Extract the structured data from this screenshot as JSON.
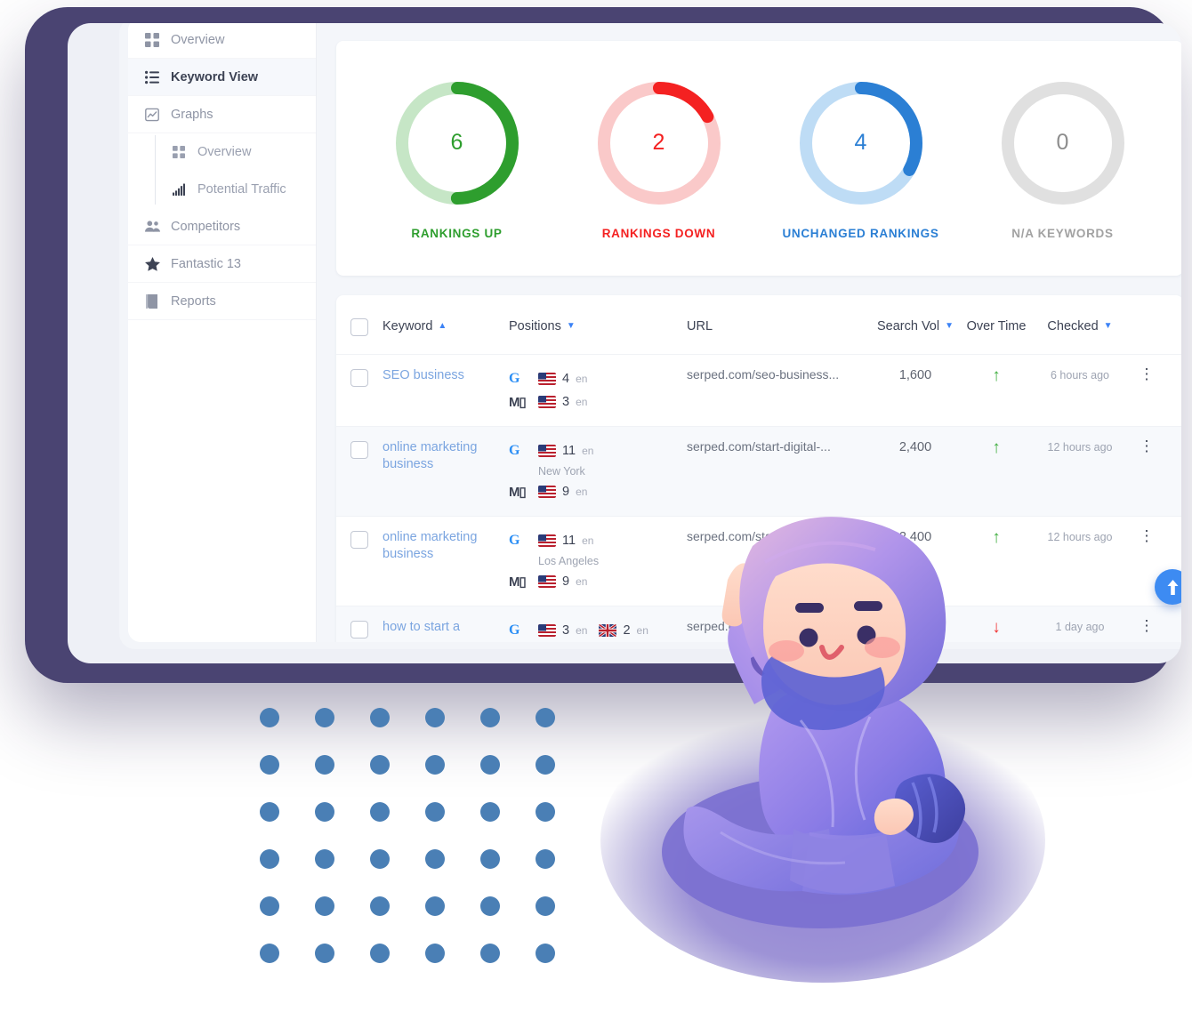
{
  "sidebar": {
    "items": [
      {
        "label": "Overview",
        "icon": "grid-icon",
        "active": false
      },
      {
        "label": "Keyword View",
        "icon": "list-icon",
        "active": true
      },
      {
        "label": "Graphs",
        "icon": "chart-area-icon",
        "active": false
      },
      {
        "label": "Competitors",
        "icon": "users-icon",
        "active": false
      },
      {
        "label": "Fantastic 13",
        "icon": "star-icon",
        "active": false
      },
      {
        "label": "Reports",
        "icon": "book-icon",
        "active": false
      }
    ],
    "sub_items": [
      {
        "label": "Overview",
        "icon": "grid-icon"
      },
      {
        "label": "Potential Traffic",
        "icon": "bar-chart-icon"
      }
    ]
  },
  "stats": [
    {
      "value": "6",
      "label": "RANKINGS UP",
      "color": "#2e9e2e",
      "track": "#c6e6c6",
      "percent": 50
    },
    {
      "value": "2",
      "label": "RANKINGS DOWN",
      "color": "#f42121",
      "track": "#fac9c9",
      "percent": 17
    },
    {
      "value": "4",
      "label": "UNCHANGED RANKINGS",
      "color": "#2b7fd4",
      "track": "#bedcf5",
      "percent": 33
    },
    {
      "value": "0",
      "label": "N/A KEYWORDS",
      "color": "#a0a0a0",
      "track": "#e0e0e0",
      "percent": 0
    }
  ],
  "table": {
    "columns": [
      {
        "label": "Keyword",
        "sort": "asc"
      },
      {
        "label": "Positions",
        "sort": "desc"
      },
      {
        "label": "URL",
        "sort": null
      },
      {
        "label": "Search Vol",
        "sort": "desc"
      },
      {
        "label": "Over Time",
        "sort": null
      },
      {
        "label": "Checked",
        "sort": "desc"
      }
    ],
    "rows": [
      {
        "keyword": "SEO business",
        "positions": [
          {
            "engine": "G",
            "flag": "us",
            "rank": "4",
            "lang": "en",
            "location": ""
          },
          {
            "engine": "M",
            "flag": "us",
            "rank": "3",
            "lang": "en",
            "location": ""
          }
        ],
        "url": "serped.com/seo-business...",
        "volume": "1,600",
        "trend": "up",
        "checked": "6 hours ago"
      },
      {
        "keyword": "online marketing business",
        "positions": [
          {
            "engine": "G",
            "flag": "us",
            "rank": "11",
            "lang": "en",
            "location": "New York"
          },
          {
            "engine": "M",
            "flag": "us",
            "rank": "9",
            "lang": "en",
            "location": ""
          }
        ],
        "url": "serped.com/start-digital-...",
        "volume": "2,400",
        "trend": "up",
        "checked": "12 hours ago"
      },
      {
        "keyword": "online marketing business",
        "positions": [
          {
            "engine": "G",
            "flag": "us",
            "rank": "11",
            "lang": "en",
            "location": "Los Angeles"
          },
          {
            "engine": "M",
            "flag": "us",
            "rank": "9",
            "lang": "en",
            "location": ""
          }
        ],
        "url": "serped.com/start-digital-...",
        "volume": "2,400",
        "trend": "up",
        "checked": "12 hours ago"
      },
      {
        "keyword": "how to start a",
        "positions": [
          {
            "engine": "G",
            "flag": "us",
            "rank": "3",
            "lang": "en",
            "location": "",
            "second_flag": "gb",
            "second_rank": "2",
            "second_lang": "en"
          }
        ],
        "url": "serped.com/start-digital-...",
        "volume": "",
        "trend": "down",
        "checked": "1 day ago"
      }
    ]
  },
  "fab": {
    "icon": "arrow-up-icon",
    "color": "#3d8bf2"
  },
  "glyphs": {
    "caret_up": "▲",
    "caret_down": "▼",
    "arrow_up": "↑",
    "arrow_down": "↓",
    "kebab": "⋮"
  }
}
